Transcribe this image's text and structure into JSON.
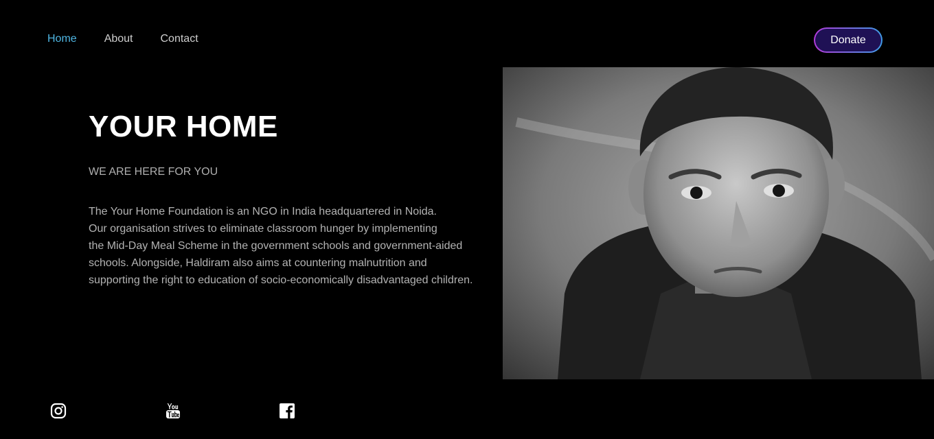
{
  "nav": {
    "items": [
      {
        "label": "Home",
        "active": true
      },
      {
        "label": "About",
        "active": false
      },
      {
        "label": "Contact",
        "active": false
      }
    ],
    "donate_label": "Donate"
  },
  "hero": {
    "title": "YOUR HOME",
    "subtitle": "WE ARE HERE FOR YOU",
    "body_lines": [
      "The Your Home Foundation is an NGO in India headquartered in Noida.",
      "Our organisation strives to eliminate classroom hunger by implementing",
      "the Mid-Day Meal Scheme in the government schools and government-aided",
      "schools. Alongside, Haldiram also aims at countering malnutrition and",
      "supporting the right to education of socio-economically disadvantaged children."
    ]
  },
  "photo": {
    "subject": "black and white portrait of a young boy"
  },
  "social": {
    "icons": [
      "instagram-icon",
      "youtube-icon",
      "facebook-icon"
    ]
  },
  "colors": {
    "background": "#000000",
    "nav_active": "#4fb6e3",
    "donate_fill": "#1f1155",
    "donate_border_start": "#b23ad8",
    "donate_border_end": "#3f9be6"
  }
}
